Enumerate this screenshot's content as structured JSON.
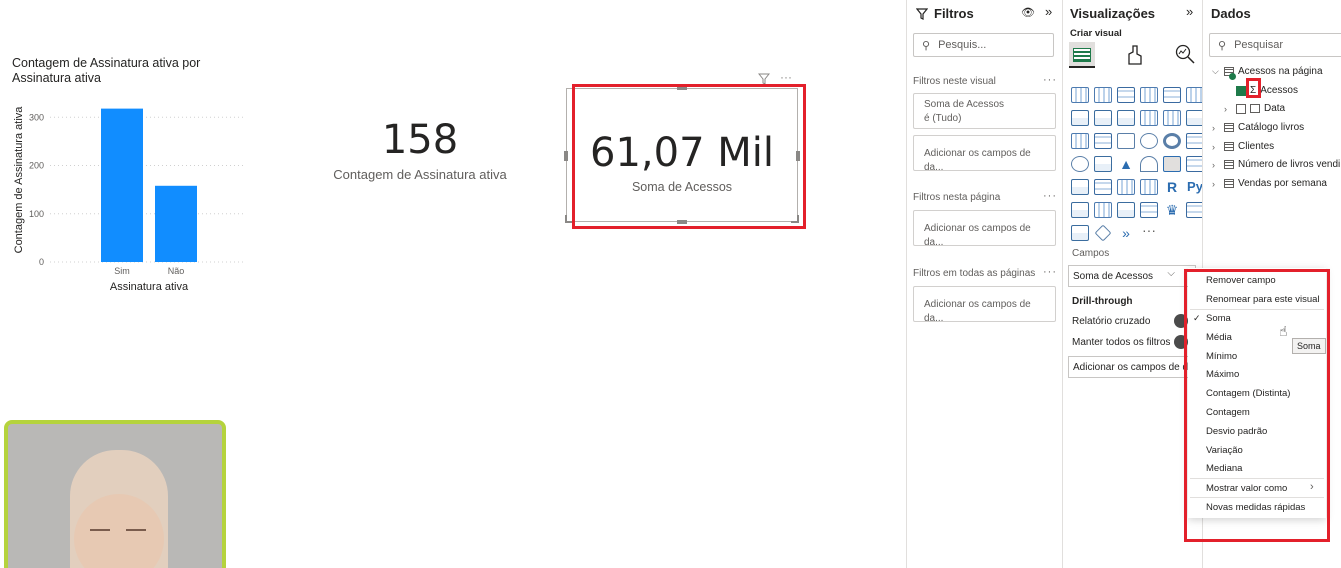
{
  "report": {
    "chart_title": "Contagem de Assinatura ativa por Assinatura ativa",
    "card1": {
      "value": "158",
      "label": "Contagem de Assinatura ativa"
    },
    "card2": {
      "value": "61,07 Mil",
      "label": "Soma de Acessos"
    }
  },
  "chart_data": {
    "type": "bar",
    "title": "Contagem de Assinatura ativa por Assinatura ativa",
    "categories": [
      "Sim",
      "Não"
    ],
    "values": [
      318,
      158
    ],
    "xlabel": "Assinatura ativa",
    "ylabel": "Contagem de Assinatura ativa",
    "ylim": [
      0,
      340
    ],
    "yticks": [
      0,
      100,
      200,
      300
    ],
    "color": "#118DFF",
    "grid": true
  },
  "filters": {
    "title": "Filtros",
    "search_placeholder": "Pesquis...",
    "section_visual": "Filtros neste visual",
    "visual_card_line1": "Soma de Acessos",
    "visual_card_line2": "é (Tudo)",
    "add_fields": "Adicionar os campos de da...",
    "section_page": "Filtros nesta página",
    "section_all": "Filtros em todas as páginas"
  },
  "visualizations": {
    "title": "Visualizações",
    "build": "Criar visual",
    "r_label": "R",
    "py_label": "Py",
    "fields_label": "Campos",
    "field_value": "Soma de Acessos",
    "drill": "Drill-through",
    "cross_report": "Relatório cruzado",
    "keep_filters": "Manter todos os filtros",
    "add_drill": "Adicionar os campos de dr"
  },
  "data_pane": {
    "title": "Dados",
    "search_placeholder": "Pesquisar",
    "tree": [
      {
        "label": "Acessos na página"
      },
      {
        "label": "Acessos"
      },
      {
        "label": "Data"
      },
      {
        "label": "Catálogo livros"
      },
      {
        "label": "Clientes"
      },
      {
        "label": "Número de livros vendi..."
      },
      {
        "label": "Vendas por semana"
      }
    ]
  },
  "context_menu": {
    "items": [
      "Remover campo",
      "Renomear para este visual",
      "Soma",
      "Média",
      "Mínimo",
      "Máximo",
      "Contagem (Distinta)",
      "Contagem",
      "Desvio padrão",
      "Variação",
      "Mediana",
      "Mostrar valor como",
      "Novas medidas rápidas"
    ],
    "checked": "Soma",
    "tooltip": "Soma"
  },
  "colors": {
    "accent": "#118DFF",
    "highlight": "#E3202B",
    "webcam_border": "#B5D33D"
  }
}
